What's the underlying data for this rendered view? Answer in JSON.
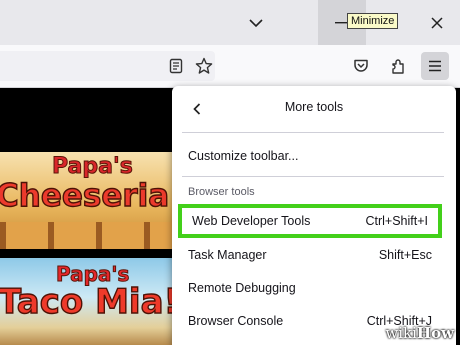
{
  "window": {
    "tooltip": "Minimize",
    "tab_list_icon": "chevron-down-icon",
    "minimize_icon": "minimize-icon",
    "close_icon": "close-icon"
  },
  "toolbar": {
    "reader_icon": "reader-view-icon",
    "bookmark_icon": "star-icon",
    "pocket_icon": "pocket-icon",
    "extensions_icon": "extensions-icon",
    "menu_icon": "hamburger-menu-icon"
  },
  "content": {
    "game1_title": [
      "Papa's",
      "Cheeseria"
    ],
    "game2_title": [
      "Papa's",
      "Taco Mia!"
    ]
  },
  "menu": {
    "title": "More tools",
    "items": [
      {
        "label": "Customize toolbar...",
        "shortcut": ""
      },
      {
        "label": "Web Developer Tools",
        "shortcut": "Ctrl+Shift+I"
      },
      {
        "label": "Task Manager",
        "shortcut": "Shift+Esc"
      },
      {
        "label": "Remote Debugging",
        "shortcut": ""
      },
      {
        "label": "Browser Console",
        "shortcut": "Ctrl+Shift+J"
      }
    ],
    "section_label": "Browser tools"
  },
  "watermark": {
    "wiki": "wiki",
    "how": "How"
  },
  "colors": {
    "highlight": "#43d01a",
    "menu_bg": "#ffffff",
    "chrome_bg": "#e8e8ec"
  }
}
